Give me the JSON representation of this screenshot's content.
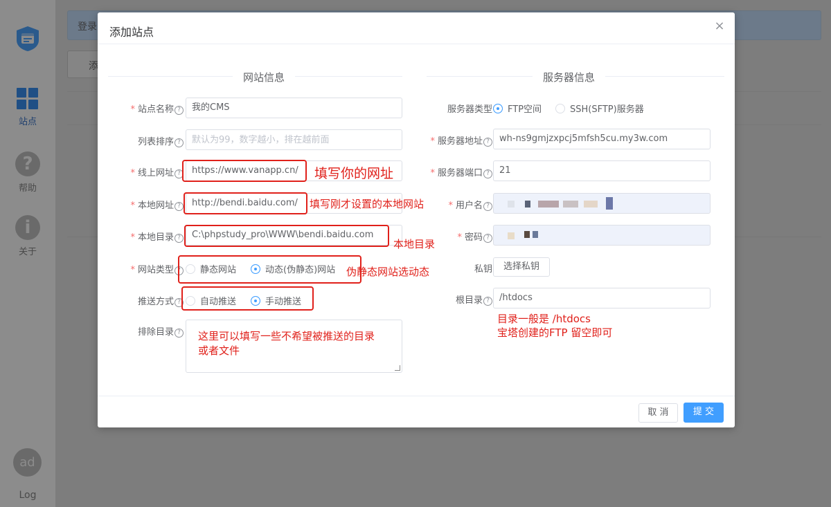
{
  "sidebar": {
    "nav": [
      {
        "label": "站点",
        "icon": "grid-icon",
        "active": true
      },
      {
        "label": "帮助",
        "icon": "?"
      },
      {
        "label": "关于",
        "icon": "i"
      }
    ],
    "avatar": "ad",
    "logout": "Log"
  },
  "background": {
    "bar_text": "登录",
    "button_text": "添"
  },
  "modal": {
    "title": "添加站点",
    "close": "×",
    "left_section": "网站信息",
    "right_section": "服务器信息",
    "help_mark": "?",
    "left_fields": {
      "site_name": {
        "label": "站点名称",
        "value": "我的CMS",
        "required": true
      },
      "list_order": {
        "label": "列表排序",
        "placeholder": "默认为99，数字越小，排在越前面"
      },
      "online_url": {
        "label": "线上网址",
        "value": "https://www.vanapp.cn/",
        "required": true
      },
      "local_url": {
        "label": "本地网址",
        "value": "http://bendi.baidu.com/",
        "required": true
      },
      "local_dir": {
        "label": "本地目录",
        "value": "C:\\phpstudy_pro\\WWW\\bendi.baidu.com",
        "required": true
      },
      "site_type": {
        "label": "网站类型",
        "options": [
          "静态网站",
          "动态(伪静态)网站"
        ],
        "selected": "动态(伪静态)网站",
        "required": true
      },
      "push_mode": {
        "label": "推送方式",
        "options": [
          "自动推送",
          "手动推送"
        ],
        "selected": "手动推送"
      },
      "exclude_dir": {
        "label": "排除目录"
      }
    },
    "right_fields": {
      "server_type": {
        "label": "服务器类型",
        "options": [
          "FTP空间",
          "SSH(SFTP)服务器"
        ],
        "selected": "FTP空间"
      },
      "server_addr": {
        "label": "服务器地址",
        "value": "wh-ns9gmjzxpcj5mfsh5cu.my3w.com",
        "required": true
      },
      "server_port": {
        "label": "服务器端口",
        "value": "21",
        "required": true
      },
      "username": {
        "label": "用户名",
        "required": true
      },
      "password": {
        "label": "密码",
        "required": true
      },
      "private_key": {
        "label": "私钥",
        "button": "选择私钥"
      },
      "root_dir": {
        "label": "根目录",
        "value": "/htdocs"
      }
    },
    "footer": {
      "cancel": "取 消",
      "submit": "提 交"
    }
  },
  "annotations": {
    "online_url_note": "填写你的网址",
    "local_url_note": "填写刚才设置的本地网站",
    "local_dir_note": "本地目录",
    "site_type_note": "伪静态网站选动态",
    "exclude_note_line1": "这里可以填写一些不希望被推送的目录",
    "exclude_note_line2": "或者文件",
    "root_note_line1": "目录一般是 /htdocs",
    "root_note_line2": "宝塔创建的FTP 留空即可"
  },
  "colors": {
    "primary": "#409eff",
    "required": "#f56c6c",
    "annotation": "#e0201a",
    "overlay": "#7d7d7d"
  }
}
